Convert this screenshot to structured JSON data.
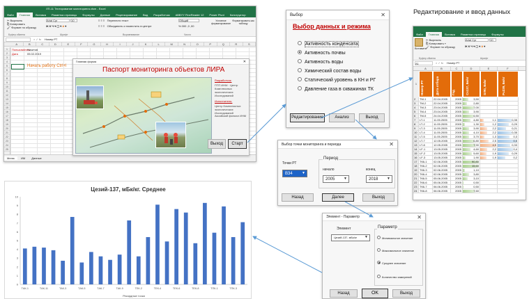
{
  "excel1": {
    "title": "ЛП-11 Тестирование мониторинга.xlsm - Excel",
    "tabs": [
      "Файл",
      "Главная",
      "Вставка",
      "Разметка страницы",
      "Формулы",
      "Данные",
      "Рецензирование",
      "Вид",
      "Разработчик",
      "ABBYY FineReader 12",
      "Power Pivot",
      "Конструктор"
    ],
    "active_tab": "Главная",
    "ribbon": {
      "cut": "Вырезать",
      "copy": "Копировать",
      "format_painter": "Формат по образцу",
      "clipboard": "Буфер обмена",
      "font_name": "Arial Cyr",
      "font_size": "10",
      "font": "Шрифт",
      "wrap": "Перенести текст",
      "merge": "Объединить и поместить в центре",
      "alignment": "Выравнивание",
      "number_format": "Общий",
      "number": "Число",
      "cond_format": "Условное форматирование",
      "format_table": "Форматировать как таблицу"
    },
    "name_box": "",
    "formula": "Номер РТ",
    "columns": [
      "A",
      "B",
      "C",
      "D",
      "E",
      "F",
      "G",
      "H",
      "I",
      "J",
      "K",
      "L",
      "M",
      "N",
      "O",
      "P",
      "Q",
      "R",
      "S"
    ],
    "cells": {
      "a1": "Пользователь",
      "b1": "Никитов",
      "a2": "Дата",
      "b2": "05.02.2019",
      "start": "Начать работу Ctrl+l"
    },
    "sheets": [
      "Меню",
      "ИМ",
      "Данные"
    ]
  },
  "main_form": {
    "window_title": "Главная форма",
    "heading": "Паспорт мониторинга объектов ЛИРА",
    "developer_label": "Разработчик:",
    "developer": "ПТП ИНМ · Центр Комплексных экологических Исследований",
    "customer_label": "Исполнитель:",
    "customer": "Центр Комплексных экологических Исследований",
    "customer_2": "Аксайский филиал ИНМ",
    "exit_btn": "Выход",
    "start_btn": "Старт"
  },
  "select_dialog": {
    "title": "Выбор",
    "heading": "Выбор данных и режима",
    "options": [
      "Активность конденсата",
      "Активность почвы",
      "Активность воды",
      "Химический состав воды",
      "Статический уровень в КН и РГ",
      "Давление газа в скважинах ТК"
    ],
    "selected_index": 1,
    "edit_btn": "Редактирование",
    "analysis_btn": "Анализ",
    "exit_btn": "Выход"
  },
  "point_dialog": {
    "title": "Выбор точки мониторинга и периода",
    "points_label": "Точки РТ",
    "points_value": "ВЗ4",
    "period_label": "Период",
    "start_label": "начало",
    "end_label": "конец",
    "start_value": "2005",
    "end_value": "2018",
    "back_btn": "Назад",
    "next_btn": "Далее",
    "exit_btn": "Выход"
  },
  "param_dialog": {
    "title": "Элемент - Параметр",
    "element_label": "Элемент",
    "element_value": "Цезий-137, мБк/кг",
    "param_label": "Параметр",
    "options": [
      "Минимальное значение",
      "Максимальное значение",
      "Среднее значение",
      "Количество измерений"
    ],
    "selected_index": 2,
    "back_btn": "Назад",
    "ok_btn": "OK",
    "exit_btn": "Выход"
  },
  "edit_title": "Редактирование и ввод данных",
  "excel2": {
    "tabs": [
      "Файл",
      "Главная",
      "Вставка",
      "Разметка страницы",
      "Формулы"
    ],
    "active_tab": "Главная",
    "ribbon": {
      "cut": "Вырезать",
      "copy": "Копировать",
      "format_painter": "Формат по образцу",
      "paste": "Вставить",
      "clipboard": "Буфер обмена",
      "font_name": "Arial Cyr",
      "font_size": "10",
      "font": "Шрифт"
    },
    "name_box": "A1",
    "formula": "Номер РТ",
    "columns": [
      "A",
      "B",
      "C",
      "D",
      "E",
      "F"
    ],
    "headers": [
      "Номер РТ",
      "Дата отбора",
      "Год",
      "Cs137, Бк/кг",
      "Sr90, Бк/кг",
      "Pu239, Бк/кг"
    ],
    "rows": [
      {
        "n": "2",
        "a": "ТМ-1",
        "b": "22.04.2005",
        "c": "2005",
        "d": "3,50",
        "e": "",
        "f": ""
      },
      {
        "n": "3",
        "a": "ТМ-2",
        "b": "22.04.2005",
        "c": "2005",
        "d": "2,80",
        "e": "",
        "f": ""
      },
      {
        "n": "4",
        "a": "ТМ-3",
        "b": "23.04.2005",
        "c": "2005",
        "d": "7,00",
        "e": "",
        "f": ""
      },
      {
        "n": "5",
        "a": "ТМ-4",
        "b": "23.04.2005",
        "c": "2005",
        "d": "3,90",
        "e": "",
        "f": ""
      },
      {
        "n": "6",
        "a": "ТМ-5",
        "b": "24.04.2005",
        "c": "2005",
        "d": "6,50",
        "e": "",
        "f": ""
      },
      {
        "n": "7",
        "a": "LT-1",
        "b": "11.05.2005",
        "c": "2005",
        "d": "4,80",
        "e": "1,1",
        "f": "0,35"
      },
      {
        "n": "8",
        "a": "LT-2",
        "b": "11.05.2005",
        "c": "2005",
        "d": "1,30",
        "e": "1,2",
        "f": "0,29"
      },
      {
        "n": "9",
        "a": "LT-3",
        "b": "11.05.2005",
        "c": "2005",
        "d": "3,90",
        "e": "2,2",
        "f": "0,21"
      },
      {
        "n": "10",
        "a": "LT-4",
        "b": "11.05.2005",
        "c": "2005",
        "d": "4,10",
        "e": "2,2",
        "f": "0,35"
      },
      {
        "n": "11",
        "a": "LT-5",
        "b": "11.05.2005",
        "c": "2005",
        "d": "3,70",
        "e": "1,3",
        "f": "0,3"
      },
      {
        "n": "12",
        "a": "LT-7",
        "b": "12.05.2005",
        "c": "2005",
        "d": "6,80",
        "e": "2,5",
        "f": "0,5"
      },
      {
        "n": "13",
        "a": "LT-8",
        "b": "12.05.2005",
        "c": "2005",
        "d": "7,90",
        "e": "4,9",
        "f": "0,33"
      },
      {
        "n": "14",
        "a": "LF-1",
        "b": "13.05.2005",
        "c": "2005",
        "d": "4,60",
        "e": "2,2",
        "f": "0,4"
      },
      {
        "n": "15",
        "a": "LF-2",
        "b": "13.05.2005",
        "c": "2005",
        "d": "5,60",
        "e": "1,9",
        "f": "0,29"
      },
      {
        "n": "16",
        "a": "LF-3",
        "b": "13.05.2005",
        "c": "2005",
        "d": "1,90",
        "e": "1,9",
        "f": "0,2"
      },
      {
        "n": "17",
        "a": "ТК6-1",
        "b": "02.06.2005",
        "c": "2005",
        "d": "90,80",
        "e": "",
        "f": ""
      },
      {
        "n": "18",
        "a": "ТК6-2",
        "b": "02.06.2005",
        "c": "2005",
        "d": "15,60",
        "e": "",
        "f": ""
      },
      {
        "n": "19",
        "a": "ТК6-3",
        "b": "02.06.2005",
        "c": "2005",
        "d": "1,10",
        "e": "",
        "f": ""
      },
      {
        "n": "20",
        "a": "ТК6-4",
        "b": "02.06.2005",
        "c": "2005",
        "d": "3,80",
        "e": "",
        "f": ""
      },
      {
        "n": "21",
        "a": "ТК6-5",
        "b": "05.06.2005",
        "c": "2005",
        "d": "3,10",
        "e": "",
        "f": ""
      },
      {
        "n": "22",
        "a": "ТК6-6",
        "b": "05.06.2005",
        "c": "2005",
        "d": "0,50",
        "e": "",
        "f": ""
      },
      {
        "n": "23",
        "a": "ТК6-7",
        "b": "06.06.2005",
        "c": "2005",
        "d": "0,50",
        "e": "",
        "f": ""
      },
      {
        "n": "24",
        "a": "ТК6-8",
        "b": "06.06.2005",
        "c": "2005",
        "d": "7,60",
        "e": "",
        "f": ""
      }
    ]
  },
  "chart_data": {
    "type": "bar",
    "title": "Цезий-137, мБк/кг. Среднее",
    "xlabel": "Рекордные точки",
    "ylabel": "",
    "ylim": [
      0,
      10
    ],
    "yticks": [
      "0",
      "1",
      "2",
      "3",
      "4",
      "5",
      "6",
      "7",
      "8",
      "9",
      "10"
    ],
    "categories": [
      "ТАК-1",
      "ТАК-10",
      "ТАК-11",
      "ТАК-2",
      "ТАК-3",
      "ТАК-4",
      "ТАК-5",
      "ТАК-6",
      "ТАК-7",
      "ТАК-8",
      "ТАК-9",
      "ТЕК-1",
      "ТЕК-2",
      "ТЕК-3",
      "ТЕК-4",
      "ТЕК-5",
      "ТЕК-6",
      "ТЕК-7",
      "ТЕК-8",
      "ТЕК-9",
      "ТПК-1",
      "ТПК-2",
      "ТПК-3",
      "ТПК-4"
    ],
    "xtick_labels": [
      "ТАК-1",
      "ТАК-11",
      "ТАК-3",
      "ТАК-5",
      "ТАК-7",
      "ТАК-9",
      "ТЕК-2",
      "ТЕК-4",
      "ТЕК-6",
      "ТЕК-8",
      "ТПК-1",
      "ТПК-3"
    ],
    "values": [
      4.1,
      4.3,
      4.2,
      3.9,
      2.7,
      7.7,
      2.5,
      3.7,
      3.2,
      2.8,
      3.4,
      7.3,
      3.2,
      5.4,
      9.1,
      4.9,
      8.6,
      8.2,
      4.7,
      9.3,
      5.9,
      8.9,
      5.4,
      7.1
    ],
    "bar_color": "#4472c4",
    "grid": false
  }
}
